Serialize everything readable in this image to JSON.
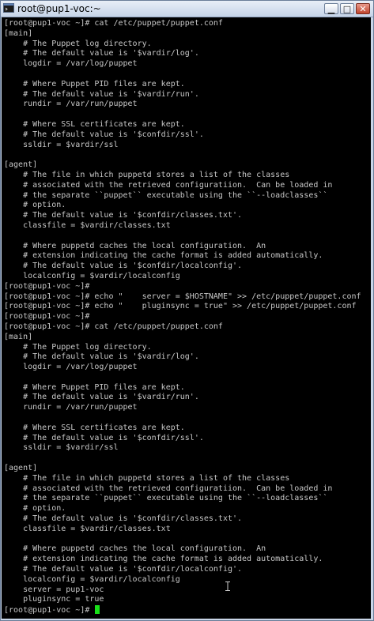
{
  "window": {
    "title": "root@pup1-voc:~",
    "min_glyph": "▁",
    "max_glyph": "□",
    "close_glyph": "✕"
  },
  "terminal": {
    "lines": [
      "[root@pup1-voc ~]# cat /etc/puppet/puppet.conf",
      "[main]",
      "    # The Puppet log directory.",
      "    # The default value is '$vardir/log'.",
      "    logdir = /var/log/puppet",
      "",
      "    # Where Puppet PID files are kept.",
      "    # The default value is '$vardir/run'.",
      "    rundir = /var/run/puppet",
      "",
      "    # Where SSL certificates are kept.",
      "    # The default value is '$confdir/ssl'.",
      "    ssldir = $vardir/ssl",
      "",
      "[agent]",
      "    # The file in which puppetd stores a list of the classes",
      "    # associated with the retrieved configuratiion.  Can be loaded in",
      "    # the separate ``puppet`` executable using the ``--loadclasses``",
      "    # option.",
      "    # The default value is '$confdir/classes.txt'.",
      "    classfile = $vardir/classes.txt",
      "",
      "    # Where puppetd caches the local configuration.  An",
      "    # extension indicating the cache format is added automatically.",
      "    # The default value is '$confdir/localconfig'.",
      "    localconfig = $vardir/localconfig",
      "[root@pup1-voc ~]#",
      "[root@pup1-voc ~]# echo \"    server = $HOSTNAME\" >> /etc/puppet/puppet.conf",
      "[root@pup1-voc ~]# echo \"    pluginsync = true\" >> /etc/puppet/puppet.conf",
      "[root@pup1-voc ~]#",
      "[root@pup1-voc ~]# cat /etc/puppet/puppet.conf",
      "[main]",
      "    # The Puppet log directory.",
      "    # The default value is '$vardir/log'.",
      "    logdir = /var/log/puppet",
      "",
      "    # Where Puppet PID files are kept.",
      "    # The default value is '$vardir/run'.",
      "    rundir = /var/run/puppet",
      "",
      "    # Where SSL certificates are kept.",
      "    # The default value is '$confdir/ssl'.",
      "    ssldir = $vardir/ssl",
      "",
      "[agent]",
      "    # The file in which puppetd stores a list of the classes",
      "    # associated with the retrieved configuratiion.  Can be loaded in",
      "    # the separate ``puppet`` executable using the ``--loadclasses``",
      "    # option.",
      "    # The default value is '$confdir/classes.txt'.",
      "    classfile = $vardir/classes.txt",
      "",
      "    # Where puppetd caches the local configuration.  An",
      "    # extension indicating the cache format is added automatically.",
      "    # The default value is '$confdir/localconfig'.",
      "    localconfig = $vardir/localconfig",
      "    server = pup1-voc",
      "    pluginsync = true"
    ],
    "prompt": "[root@pup1-voc ~]# ",
    "cursor_color": "#18e018"
  }
}
